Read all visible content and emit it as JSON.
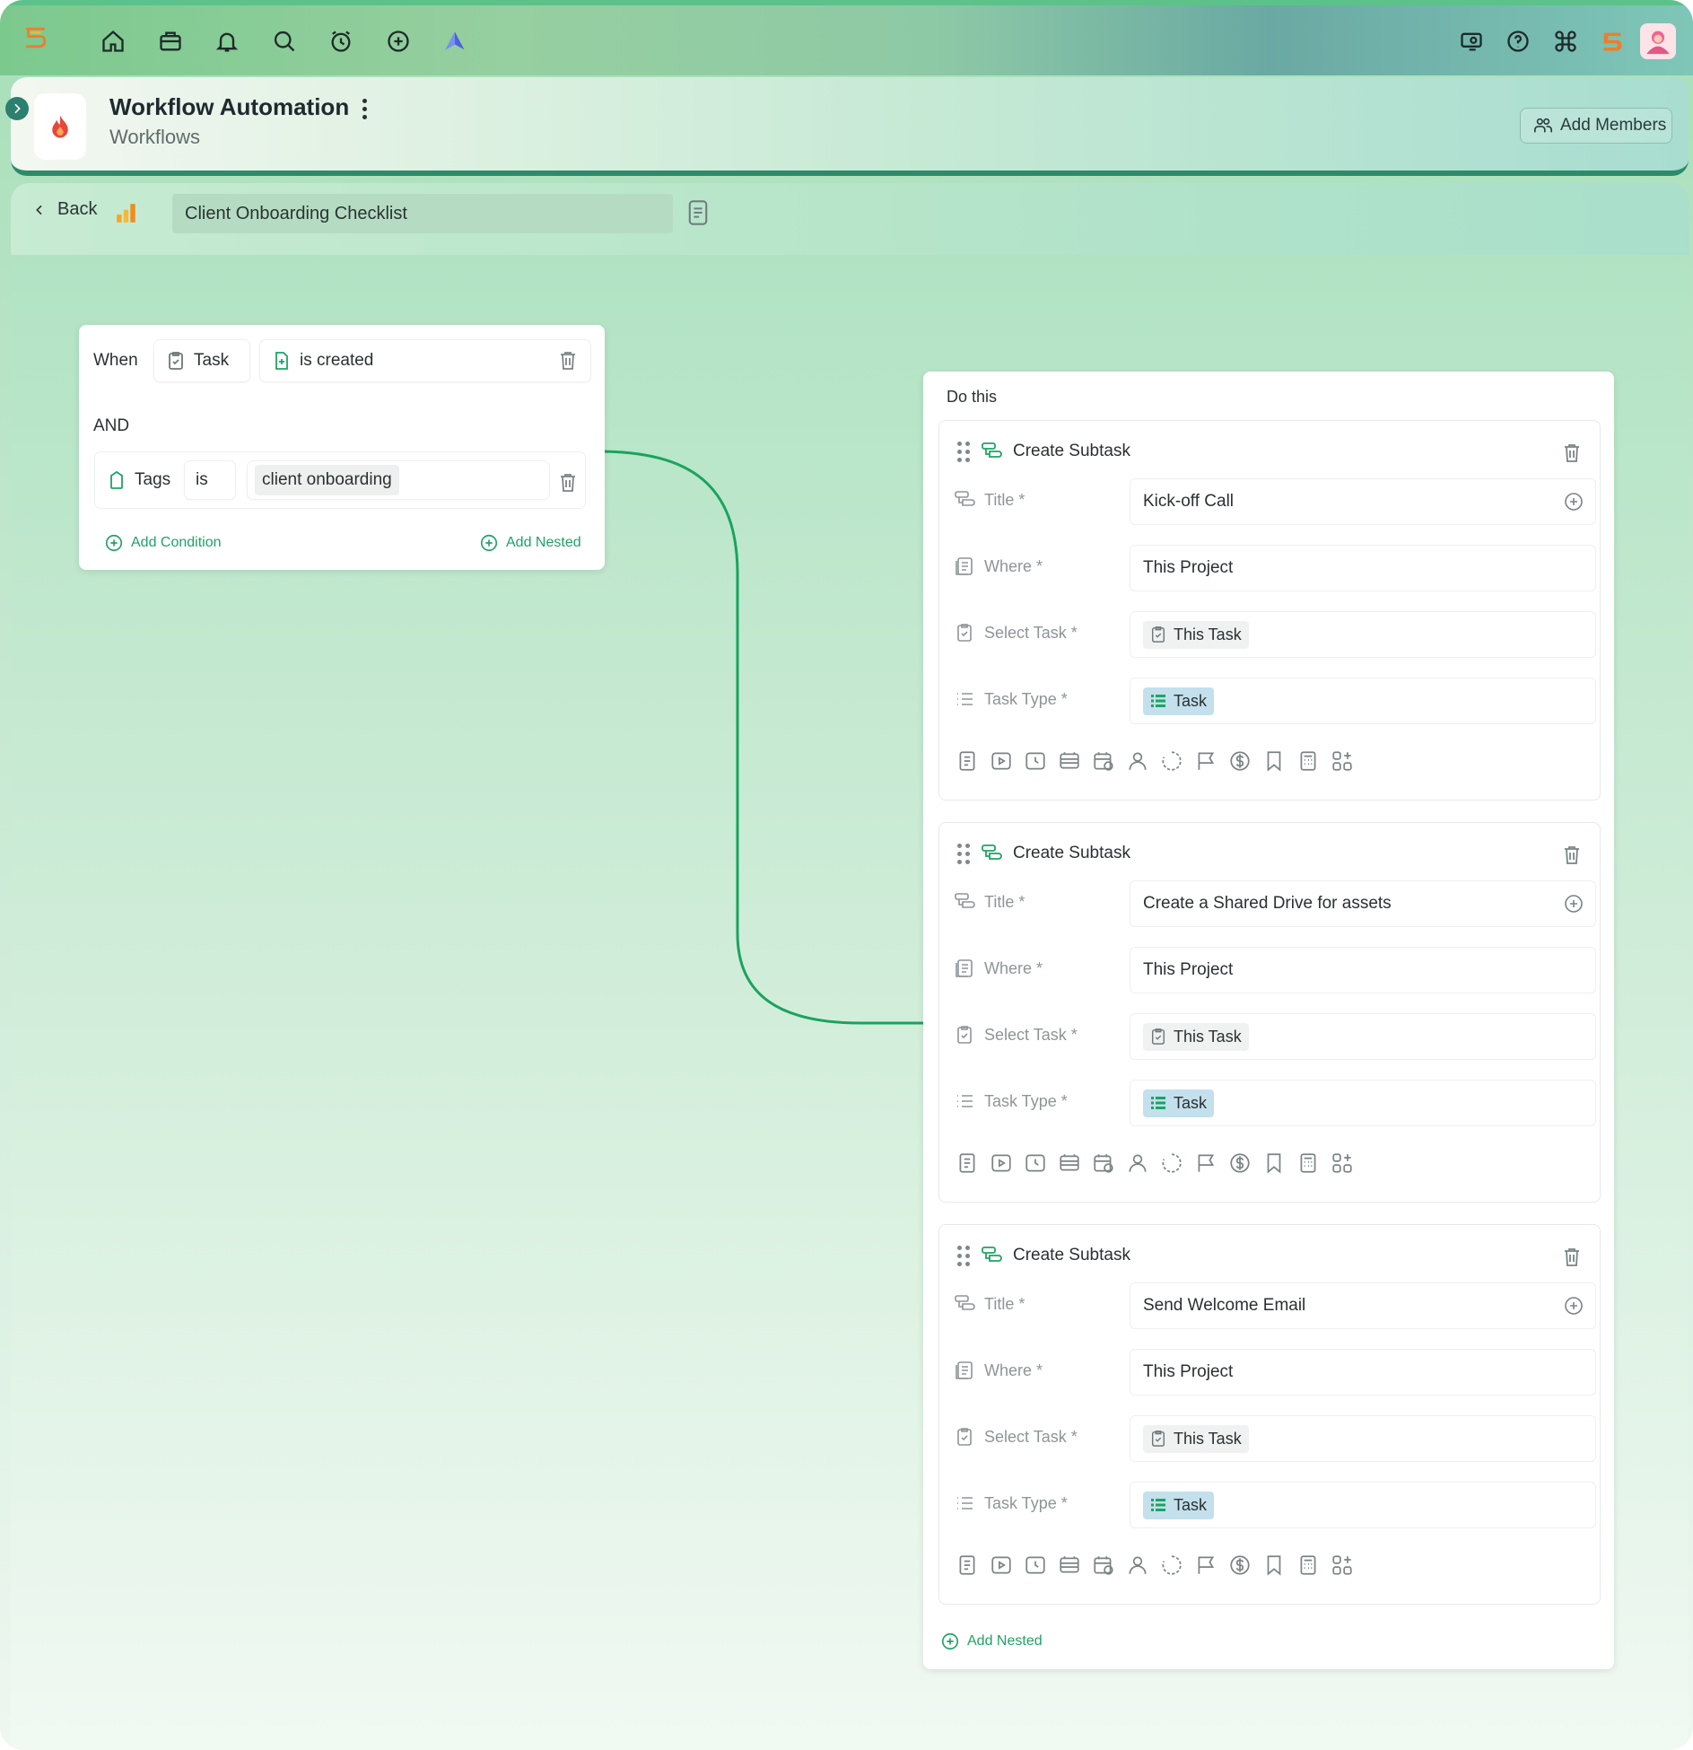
{
  "header": {
    "title": "Workflow Automation",
    "subtitle": "Workflows",
    "add_members_label": "Add Members"
  },
  "toolbar": {
    "back_label": "Back",
    "workflow_name": "Client Onboarding Checklist"
  },
  "trigger": {
    "when_label": "When",
    "entity": "Task",
    "event": "is created",
    "and_label": "AND",
    "condition": {
      "field": "Tags",
      "operator": "is",
      "value": "client onboarding"
    },
    "add_condition_label": "Add Condition",
    "add_nested_label": "Add Nested"
  },
  "actions": {
    "do_this_label": "Do this",
    "subtasks": [
      {
        "heading": "Create Subtask",
        "title_label": "Title *",
        "title_value": "Kick-off Call",
        "where_label": "Where *",
        "where_value": "This Project",
        "select_task_label": "Select Task *",
        "select_task_value": "This Task",
        "task_type_label": "Task Type *",
        "task_type_value": "Task"
      },
      {
        "heading": "Create Subtask",
        "title_label": "Title *",
        "title_value": "Create a Shared Drive for assets",
        "where_label": "Where *",
        "where_value": "This Project",
        "select_task_label": "Select Task *",
        "select_task_value": "This Task",
        "task_type_label": "Task Type *",
        "task_type_value": "Task"
      },
      {
        "heading": "Create Subtask",
        "title_label": "Title *",
        "title_value": "Send Welcome Email",
        "where_label": "Where *",
        "where_value": "This Project",
        "select_task_label": "Select Task *",
        "select_task_value": "This Task",
        "task_type_label": "Task Type *",
        "task_type_value": "Task"
      }
    ],
    "add_nested_label": "Add Nested"
  },
  "icons": {
    "topbar_left": [
      "logo-icon",
      "home-icon",
      "briefcase-icon",
      "bell-icon",
      "search-icon",
      "alarm-clock-icon",
      "plus-circle-icon",
      "arrow-up-icon"
    ],
    "topbar_right": [
      "support-icon",
      "help-icon",
      "command-icon",
      "brand-icon",
      "user-avatar"
    ],
    "field_toolbar": [
      "description-icon",
      "video-icon",
      "clock-icon",
      "sprint-icon",
      "calendar-icon",
      "assignee-icon",
      "status-icon",
      "flag-icon",
      "dollar-icon",
      "bookmark-icon",
      "calculator-icon",
      "apps-icon"
    ]
  },
  "colors": {
    "accent_green": "#1fa364",
    "connector_green": "#1aa35e",
    "header_border": "#2d8a6b",
    "task_type_pill": "#c3e0ec"
  }
}
